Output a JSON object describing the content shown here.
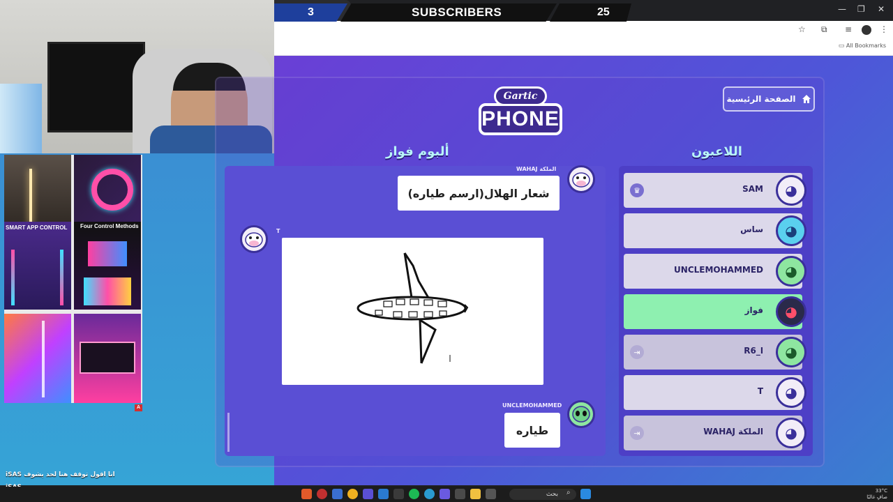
{
  "overlay": {
    "left_count": "3",
    "label": "SUBSCRIBERS",
    "right_count": "25"
  },
  "browser": {
    "bookmarks_all": "All Bookmarks",
    "tab_close": "✕",
    "new_tab": "+",
    "win_min": "—",
    "win_max": "❐",
    "win_close": "✕"
  },
  "ad": {
    "smart_app_control": "SMART APP CONTROL",
    "four_control_methods": "Four Control Methods",
    "badge": "A"
  },
  "game": {
    "home_button": "الصفحة الرئيسية",
    "logo_top": "Gartic",
    "logo_main": "PHONE",
    "album_title": "ألبوم فواز",
    "players_title": "اللاعبون",
    "album": {
      "prompt_author": "WAHAJ الملكة",
      "prompt_text": "شعار الهلال(ارسم طياره)",
      "drawing_author": "T",
      "guess_author": "UNCLEMOHAMMED",
      "guess_text": "طياره"
    },
    "players": [
      {
        "name": "SAM",
        "state": "host"
      },
      {
        "name": "ساس",
        "state": "normal"
      },
      {
        "name": "UNCLEMOHAMMED",
        "state": "normal"
      },
      {
        "name": "فواز",
        "state": "active"
      },
      {
        "name": "R6_ا",
        "state": "exit"
      },
      {
        "name": "T",
        "state": "normal"
      },
      {
        "name": "WAHAJ الملكة",
        "state": "exit"
      }
    ]
  },
  "chat": {
    "line1_user": "iSAS",
    "line1_text": "انا اقول توقف هنا لحد يشوف",
    "line2_user": "iSAS"
  },
  "taskbar": {
    "search_placeholder": "بحث",
    "tray_temp": "33°C",
    "tray_desc": "صافٍ غالبًا"
  },
  "colors": {
    "accent_purple": "#5a4fd4",
    "active_player": "#8ef0b0",
    "title_cyan": "#b8f4f8"
  }
}
